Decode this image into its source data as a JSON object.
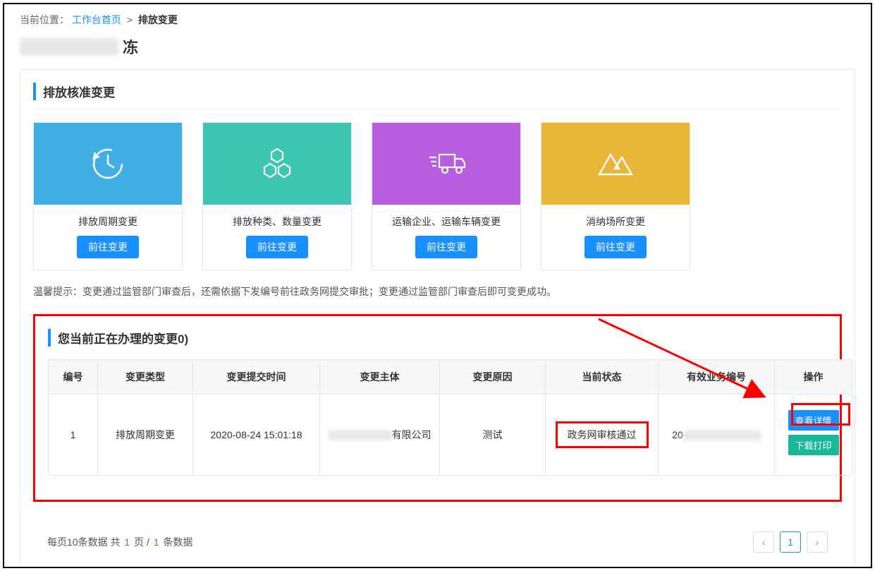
{
  "breadcrumb": {
    "label": "当前位置：",
    "home": "工作台首页",
    "sep": ">",
    "current": "排放变更"
  },
  "page_title_suffix": "冻",
  "section1_title": "排放核准变更",
  "cards": [
    {
      "label": "排放周期变更",
      "btn": "前往变更"
    },
    {
      "label": "排放种类、数量变更",
      "btn": "前往变更"
    },
    {
      "label": "运输企业、运输车辆变更",
      "btn": "前往变更"
    },
    {
      "label": "消纳场所变更",
      "btn": "前往变更"
    }
  ],
  "tip_label": "温馨提示：",
  "tip_text": "变更通过监管部门审查后，还需依据下发编号前往政务网提交审批；变更通过监管部门审查后即可变更成功。",
  "section2_title": "您当前正在办理的变更0)",
  "table": {
    "headers": [
      "编号",
      "变更类型",
      "变更提交时间",
      "变更主体",
      "变更原因",
      "当前状态",
      "有效业务编号",
      "操作"
    ],
    "row": {
      "id": "1",
      "type": "排放周期变更",
      "time": "2020-08-24 15:01:18",
      "subject_suffix": "有限公司",
      "reason": "测试",
      "status": "政务网审核通过",
      "bizno_prefix": "20",
      "op_view": "查看详情",
      "op_print": "下载打印"
    }
  },
  "pager": {
    "text_a": "每页10条数据  共 ",
    "pages": "1",
    "text_b": " 页 / ",
    "records": "1",
    "text_c": " 条数据",
    "prev": "‹",
    "page1": "1",
    "next": "›"
  }
}
